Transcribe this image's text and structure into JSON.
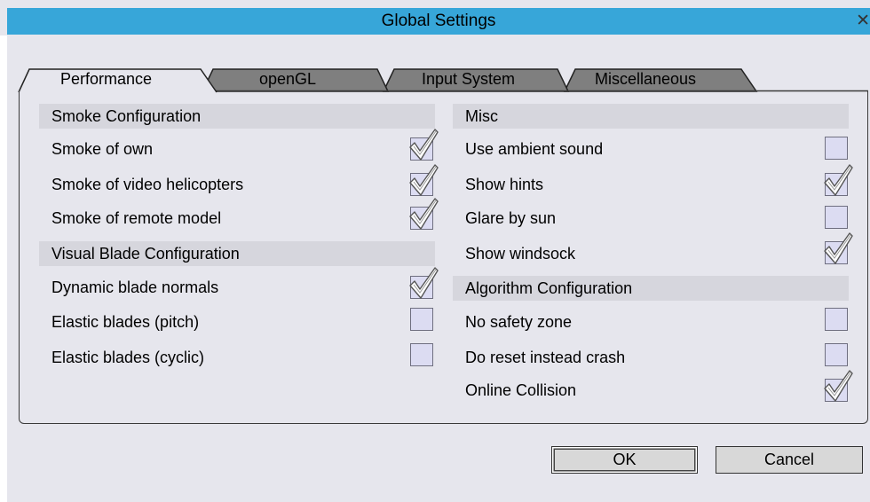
{
  "window": {
    "title": "Global Settings"
  },
  "tabs": [
    {
      "label": "Performance",
      "active": true
    },
    {
      "label": "openGL",
      "active": false
    },
    {
      "label": "Input System",
      "active": false
    },
    {
      "label": "Miscellaneous",
      "active": false
    }
  ],
  "left": {
    "smoke": {
      "heading": "Smoke Configuration",
      "items": [
        {
          "label": "Smoke of own",
          "checked": true
        },
        {
          "label": "Smoke of video helicopters",
          "checked": true
        },
        {
          "label": "Smoke of remote model",
          "checked": true
        }
      ]
    },
    "blade": {
      "heading": "Visual Blade Configuration",
      "items": [
        {
          "label": "Dynamic blade normals",
          "checked": true
        },
        {
          "label": "Elastic blades (pitch)",
          "checked": false
        },
        {
          "label": "Elastic blades (cyclic)",
          "checked": false
        }
      ]
    }
  },
  "right": {
    "misc": {
      "heading": "Misc",
      "items": [
        {
          "label": "Use ambient sound",
          "checked": false
        },
        {
          "label": "Show hints",
          "checked": true
        },
        {
          "label": "Glare by sun",
          "checked": false
        },
        {
          "label": "Show windsock",
          "checked": true
        }
      ]
    },
    "algo": {
      "heading": "Algorithm Configuration",
      "items": [
        {
          "label": "No safety zone",
          "checked": false
        },
        {
          "label": "Do reset instead crash",
          "checked": false
        },
        {
          "label": "Online Collision",
          "checked": true
        }
      ]
    }
  },
  "buttons": {
    "ok": "OK",
    "cancel": "Cancel"
  },
  "icons": {
    "close": "close-icon",
    "check": "checkmark-icon"
  },
  "colors": {
    "titlebar": "#37a6d9",
    "panel": "#e6e6ed",
    "checkbox": "#dcdcf2"
  }
}
